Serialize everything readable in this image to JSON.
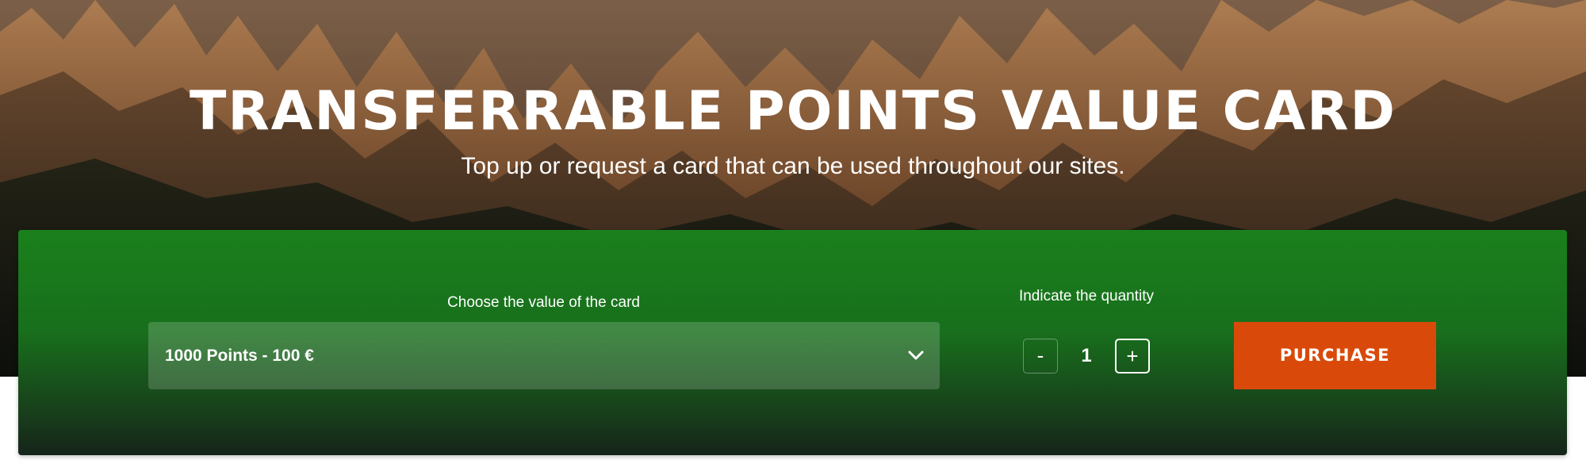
{
  "hero": {
    "title": "TRANSFERRABLE POINTS VALUE CARD",
    "subtitle": "Top up or request a card that can be used throughout our sites."
  },
  "form": {
    "value_label": "Choose the value of the card",
    "value_selected": "1000 Points - 100 €",
    "quantity_label": "Indicate the quantity",
    "quantity_minus": "-",
    "quantity_value": "1",
    "quantity_plus": "+",
    "purchase_label": "PURCHASE"
  },
  "colors": {
    "card_green": "#1a801c",
    "purchase_orange": "#d94a0a"
  },
  "icons": {
    "dropdown": "chevron-down-icon"
  }
}
